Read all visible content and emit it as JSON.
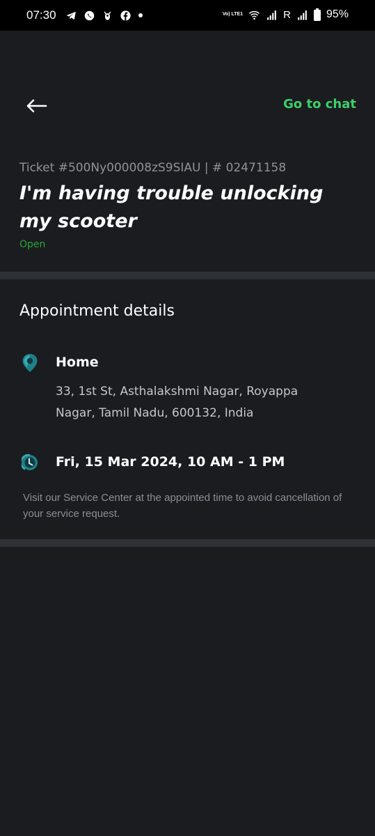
{
  "status_bar": {
    "time": "07:30",
    "left_icons": [
      "telegram-icon",
      "whatsapp-icon",
      "scooter-app-icon",
      "facebook-icon",
      "notification-dot-icon"
    ],
    "network_label": "Vo) LTE1",
    "roaming_label": "R",
    "battery": "95%"
  },
  "header": {
    "back_icon": "back-arrow-icon",
    "chat_link": "Go to chat",
    "chat_color": "#3ccf6a"
  },
  "ticket": {
    "id_line": "Ticket #500Ny000008zS9SIAU | # 02471158",
    "title": "I'm having trouble unlocking my scooter",
    "status": "Open",
    "status_color": "#26a532"
  },
  "appointment": {
    "section_title": "Appointment details",
    "location_icon": "location-pin-icon",
    "location_name": "Home",
    "address": "33, 1st St, Asthalakshmi Nagar, Royappa Nagar, Tamil Nadu, 600132, India",
    "time_icon": "clock-icon",
    "datetime": "Fri, 15 Mar 2024, 10 AM - 1 PM",
    "notice": "Visit our Service Center at the appointed time to avoid cancellation of your service request."
  }
}
